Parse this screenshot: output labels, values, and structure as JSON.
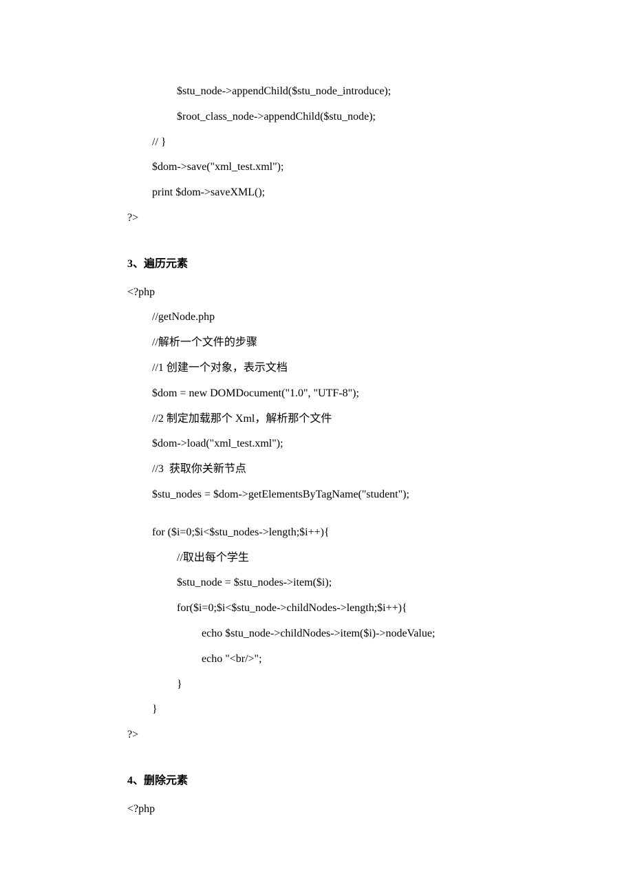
{
  "block1": {
    "l1": "$stu_node->appendChild($stu_node_introduce);",
    "l2": "$root_class_node->appendChild($stu_node);",
    "l3": "// }",
    "l4": "$dom->save(\"xml_test.xml\");",
    "l5": "print $dom->saveXML();",
    "l6": "?>"
  },
  "section3": {
    "heading": "3、遍历元素",
    "l1": "<?php",
    "l2": "//getNode.php",
    "l3": "//解析一个文件的步骤",
    "l4": "//1 创建一个对象，表示文档",
    "l5": "$dom = new DOMDocument(\"1.0\", \"UTF-8\");",
    "l6": "//2 制定加载那个 Xml，解析那个文件",
    "l7": "$dom->load(\"xml_test.xml\");",
    "l8": "//3  获取你关新节点",
    "l9": "$stu_nodes = $dom->getElementsByTagName(\"student\");",
    "l10": "for ($i=0;$i<$stu_nodes->length;$i++){",
    "l11": "//取出每个学生",
    "l12": "$stu_node = $stu_nodes->item($i);",
    "l13": "for($i=0;$i<$stu_node->childNodes->length;$i++){",
    "l14": "echo $stu_node->childNodes->item($i)->nodeValue;",
    "l15": "echo \"<br/>\";",
    "l16": "}",
    "l17": "}",
    "l18": "?>"
  },
  "section4": {
    "heading": "4、删除元素",
    "l1": "<?php"
  }
}
